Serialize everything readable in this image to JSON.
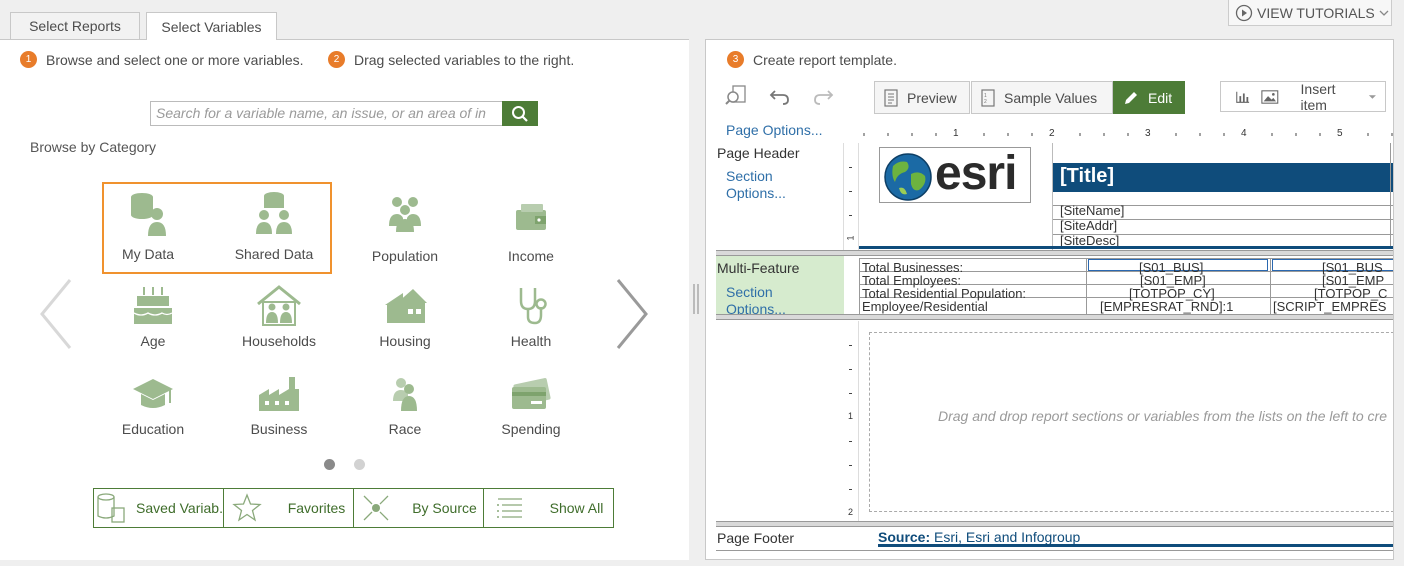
{
  "tabs": [
    {
      "label": "Select Reports"
    },
    {
      "label": "Select Variables"
    }
  ],
  "tutorials": {
    "label": "VIEW TUTORIALS"
  },
  "left": {
    "step1": {
      "num": "1",
      "text": "Browse and select one or more variables."
    },
    "step2": {
      "num": "2",
      "text": "Drag selected variables to the right."
    },
    "search": {
      "placeholder": "Search for a variable name, an issue, or an area of in"
    },
    "browse_label": "Browse by Category",
    "categories": [
      {
        "label": "My Data",
        "icon": "my-data-icon"
      },
      {
        "label": "Shared Data",
        "icon": "shared-data-icon"
      },
      {
        "label": "Population",
        "icon": "population-icon"
      },
      {
        "label": "Income",
        "icon": "income-icon"
      },
      {
        "label": "Age",
        "icon": "age-icon"
      },
      {
        "label": "Households",
        "icon": "households-icon"
      },
      {
        "label": "Housing",
        "icon": "housing-icon"
      },
      {
        "label": "Health",
        "icon": "health-icon"
      },
      {
        "label": "Education",
        "icon": "education-icon"
      },
      {
        "label": "Business",
        "icon": "business-icon"
      },
      {
        "label": "Race",
        "icon": "race-icon"
      },
      {
        "label": "Spending",
        "icon": "spending-icon"
      }
    ],
    "bottom": [
      {
        "label": "Saved Variab."
      },
      {
        "label": "Favorites"
      },
      {
        "label": "By Source"
      },
      {
        "label": "Show All"
      }
    ]
  },
  "right": {
    "step3": {
      "num": "3",
      "text": "Create report template."
    },
    "toolbar": {
      "preview": "Preview",
      "sample": "Sample Values",
      "edit": "Edit",
      "insert": "Insert item"
    },
    "page_options": "Page Options...",
    "ruler_nums": [
      "1",
      "2",
      "3",
      "4",
      "5"
    ],
    "page_header": {
      "label": "Page Header",
      "section_options": "Section Options...",
      "logo_text": "esri",
      "title": "[Title]",
      "fields": [
        "[SiteName]",
        "[SiteAddr]",
        "[SiteDesc]"
      ]
    },
    "multi_feature": {
      "label": "Multi-Feature",
      "section_options": "Section Options...",
      "rows": [
        {
          "name": "Total Businesses:",
          "v1": "[S01_BUS]",
          "v2": "[S01_BUS"
        },
        {
          "name": "Total Employees:",
          "v1": "[S01_EMP]",
          "v2": "[S01_EMP"
        },
        {
          "name": "Total Residential Population:",
          "v1": "[TOTPOP_CY]",
          "v2": "[TOTPOP_C"
        },
        {
          "name": "Employee/Residential",
          "v1": "[EMPRESRAT_RND]:1",
          "v2": "[SCRIPT_EMPRES"
        }
      ]
    },
    "drop_hint": "Drag and drop report sections or variables from the lists on the left to cre",
    "page_footer": {
      "label": "Page Footer",
      "source_bold": "Source:",
      "source_text": "Esri, Esri and Infogroup"
    }
  }
}
